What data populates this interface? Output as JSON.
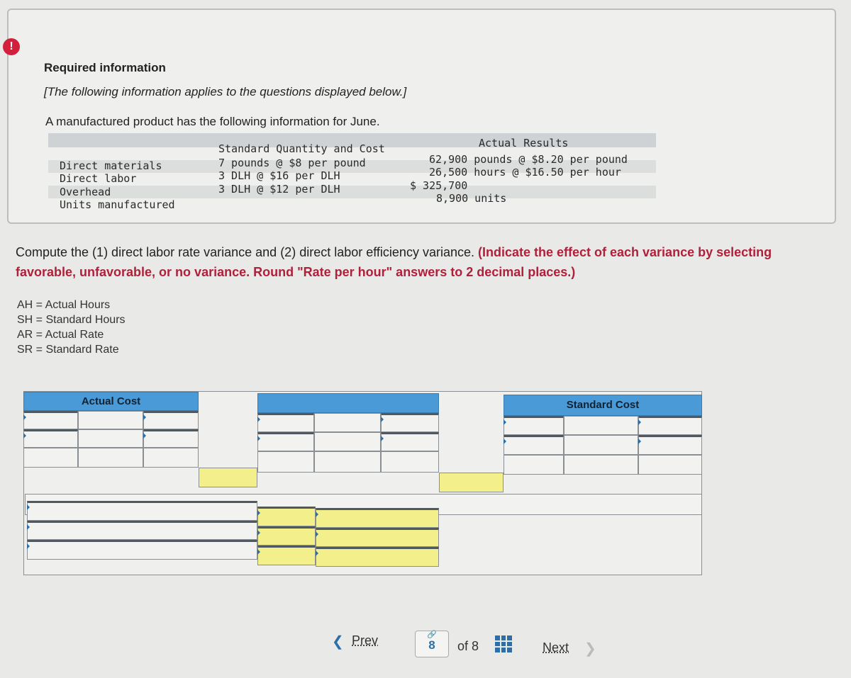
{
  "alert_icon": "exclamation-icon",
  "info": {
    "heading": "Required information",
    "note": "[The following information applies to the questions displayed below.]",
    "intro": "A manufactured product has the following information for June.",
    "table": {
      "headers": [
        "",
        "Standard Quantity and Cost",
        "Actual Results"
      ],
      "rows": [
        {
          "label": "Direct materials",
          "standard": "7 pounds @ $8 per pound",
          "actual": "62,900 pounds @ $8.20 per pound"
        },
        {
          "label": "Direct labor",
          "standard": "3 DLH @ $16 per DLH",
          "actual": "26,500 hours @ $16.50 per hour"
        },
        {
          "label": "Overhead",
          "standard": "3 DLH @ $12 per DLH",
          "actual": "$ 325,700"
        },
        {
          "label": "Units manufactured",
          "standard": "",
          "actual": "8,900 units"
        }
      ]
    }
  },
  "question": {
    "text": "Compute the (1) direct labor rate variance and (2) direct labor efficiency variance. ",
    "emphasis": "(Indicate the effect of each variance by selecting favorable, unfavorable, or no variance. Round \"Rate per hour\" answers to 2 decimal places.)"
  },
  "definitions": [
    "AH = Actual Hours",
    "SH = Standard Hours",
    "AR = Actual Rate",
    "SR = Standard Rate"
  ],
  "worksheet": {
    "actual_header": "Actual Cost",
    "middle_header": "",
    "standard_header": "Standard Cost"
  },
  "pagination": {
    "prev": "Prev",
    "current": "8",
    "of_label": "of 8",
    "next": "Next",
    "link_icon": "link-icon",
    "grid_icon": "grid-icon",
    "accent": "#2c6fa8"
  }
}
